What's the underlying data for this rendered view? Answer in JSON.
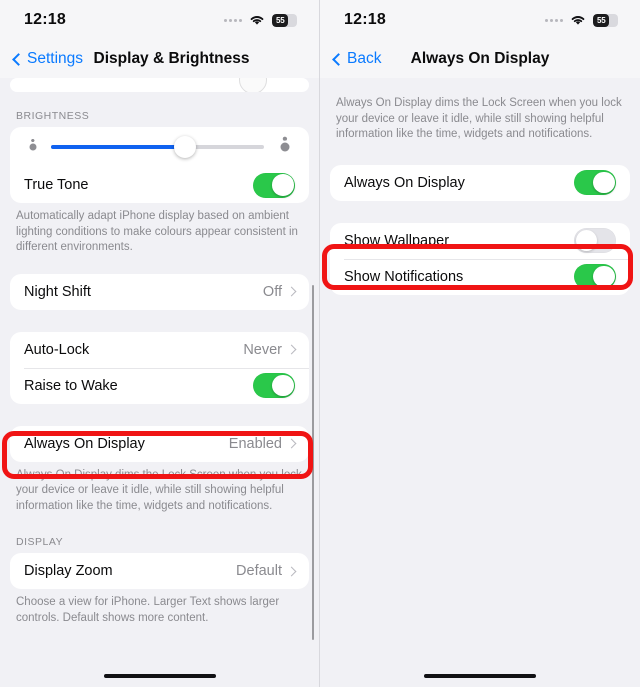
{
  "status_bar": {
    "time": "12:18",
    "battery_level": "55",
    "wifi_icon": "wifi-icon",
    "dots_icon": "signal-dots-icon"
  },
  "colors": {
    "accent_blue": "#0a7aff",
    "toggle_on_green": "#2ac84a",
    "toggle_off_gray": "#e4e4e9",
    "highlight_red": "#f01414",
    "slider_fill_blue": "#1062f0",
    "page_background": "#f1f1f5",
    "card_background": "#ffffff"
  },
  "left_screen": {
    "nav": {
      "back_label": "Settings",
      "title": "Display & Brightness"
    },
    "brightness": {
      "section_header": "BRIGHTNESS",
      "slider_value_percent": 63,
      "slider_min_icon": "sun-small-icon",
      "slider_max_icon": "sun-large-icon",
      "true_tone": {
        "label": "True Tone",
        "toggle_state": "on"
      },
      "footnote": "Automatically adapt iPhone display based on ambient lighting conditions to make colours appear consistent in different environments."
    },
    "night_shift": {
      "label": "Night Shift",
      "value": "Off"
    },
    "auto_lock": {
      "label": "Auto-Lock",
      "value": "Never"
    },
    "raise_to_wake": {
      "label": "Raise to Wake",
      "toggle_state": "on"
    },
    "always_on_display": {
      "label": "Always On Display",
      "value": "Enabled",
      "highlighted": true,
      "footnote": "Always On Display dims the Lock Screen when you lock your device or leave it idle, while still showing helpful information like the time, widgets and notifications."
    },
    "display": {
      "section_header": "DISPLAY",
      "display_zoom": {
        "label": "Display Zoom",
        "value": "Default"
      },
      "footnote": "Choose a view for iPhone. Larger Text shows larger controls. Default shows more content."
    }
  },
  "right_screen": {
    "nav": {
      "back_label": "Back",
      "title": "Always On Display"
    },
    "description": "Always On Display dims the Lock Screen when you lock your device or leave it idle, while still showing helpful information like the time, widgets and notifications.",
    "rows": [
      {
        "label": "Always On Display",
        "toggle_state": "on",
        "highlighted": false
      },
      {
        "label": "Show Wallpaper",
        "toggle_state": "off",
        "highlighted": true
      },
      {
        "label": "Show Notifications",
        "toggle_state": "on",
        "highlighted": false
      }
    ]
  }
}
